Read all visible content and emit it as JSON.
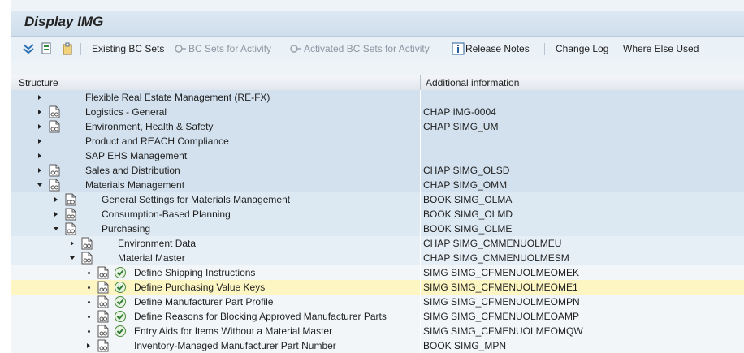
{
  "window": {
    "title": "Display IMG"
  },
  "toolbar": {
    "existing_bc_sets": "Existing BC Sets",
    "bc_sets_for_activity": "BC Sets for Activity",
    "activated_bc_sets_for_activity": "Activated BC Sets for Activity",
    "release_notes": "Release Notes",
    "change_log": "Change Log",
    "where_else_used": "Where Else Used"
  },
  "columns": {
    "structure": "Structure",
    "additional_info": "Additional information"
  },
  "rows": [
    {
      "label": "Flexible Real Estate Management (RE-FX)",
      "info": ""
    },
    {
      "label": "Logistics - General",
      "info": "CHAP IMG-0004"
    },
    {
      "label": "Environment, Health & Safety",
      "info": "CHAP SIMG_UM"
    },
    {
      "label": "Product and REACH Compliance",
      "info": ""
    },
    {
      "label": "SAP EHS Management",
      "info": ""
    },
    {
      "label": "Sales and Distribution",
      "info": "CHAP SIMG_OLSD"
    },
    {
      "label": "Materials Management",
      "info": "CHAP SIMG_OMM"
    },
    {
      "label": "General Settings for Materials Management",
      "info": "BOOK SIMG_OLMA"
    },
    {
      "label": "Consumption-Based Planning",
      "info": "BOOK SIMG_OLMD"
    },
    {
      "label": "Purchasing",
      "info": "BOOK SIMG_OLME"
    },
    {
      "label": "Environment Data",
      "info": "CHAP SIMG_CMMENUOLMEU"
    },
    {
      "label": "Material Master",
      "info": "CHAP SIMG_CMMENUOLMESM"
    },
    {
      "label": "Define Shipping Instructions",
      "info": "SIMG SIMG_CFMENUOLMEOMEK"
    },
    {
      "label": "Define Purchasing Value Keys",
      "info": "SIMG SIMG_CFMENUOLMEOME1"
    },
    {
      "label": "Define Manufacturer Part Profile",
      "info": "SIMG SIMG_CFMENUOLMEOMPN"
    },
    {
      "label": "Define Reasons for Blocking Approved Manufacturer Parts",
      "info": "SIMG SIMG_CFMENUOLMEOAMP"
    },
    {
      "label": "Entry Aids for Items Without a Material Master",
      "info": "SIMG SIMG_CFMENUOLMEOMQW"
    },
    {
      "label": "Inventory-Managed Manufacturer Part Number",
      "info": "BOOK SIMG_MPN"
    }
  ]
}
